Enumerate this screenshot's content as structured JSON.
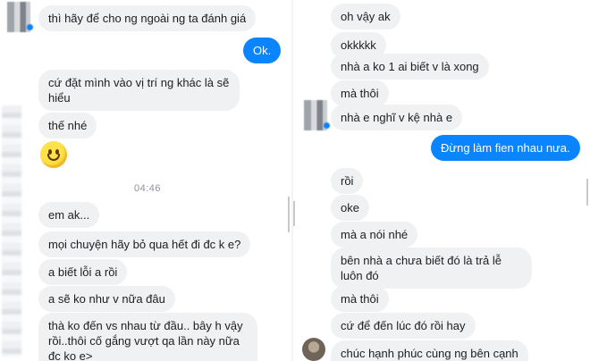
{
  "left_chat": {
    "messages": [
      {
        "text": "thì hãy để cho ng ngoài ng ta đánh giá",
        "direction": "incoming"
      },
      {
        "text": "Ok.",
        "direction": "outgoing"
      },
      {
        "text": "cứ đặt mình vào vị trí ng khác là sẽ hiểu",
        "direction": "incoming"
      },
      {
        "text": "thế nhé",
        "direction": "incoming"
      },
      {
        "emoji": "smiley-face",
        "direction": "incoming"
      },
      {
        "text": "em ak...",
        "direction": "incoming"
      },
      {
        "text": "mọi chuyện hãy bỏ qua hết đi đc k e?",
        "direction": "incoming"
      },
      {
        "text": "a biết lỗi a rồi",
        "direction": "incoming"
      },
      {
        "text": "a sẽ ko như v nữa đâu",
        "direction": "incoming"
      },
      {
        "text": "thà ko đến vs nhau từ đầu.. bây h vậy rồi..thôi cố gắng vượt qa lần này nữa đc ko e>",
        "direction": "incoming"
      }
    ],
    "timestamp": "04:46"
  },
  "right_chat": {
    "messages": [
      {
        "text": "oh vậy ak",
        "direction": "incoming"
      },
      {
        "text": "okkkkk",
        "direction": "incoming"
      },
      {
        "text": "nhà a ko 1 ai biết v là xong",
        "direction": "incoming"
      },
      {
        "text": "mà thôi",
        "direction": "incoming"
      },
      {
        "text": "nhà e nghĩ v kệ nhà e",
        "direction": "incoming"
      },
      {
        "text": "Đừng làm fien nhau nưa.",
        "direction": "outgoing"
      },
      {
        "text": "rồi",
        "direction": "incoming"
      },
      {
        "text": "oke",
        "direction": "incoming"
      },
      {
        "text": "mà a nói nhé",
        "direction": "incoming"
      },
      {
        "text": "bên nhà a chưa biết đó là trả lễ luôn đó",
        "direction": "incoming"
      },
      {
        "text": "mà thôi",
        "direction": "incoming"
      },
      {
        "text": "cứ để đến lúc đó rồi hay",
        "direction": "incoming"
      },
      {
        "text": "chúc hạnh phúc cùng ng bên cạnh",
        "direction": "incoming"
      }
    ]
  },
  "colors": {
    "incoming_bubble": "#f0f1f3",
    "outgoing_bubble": "#0a84ff",
    "timestamp": "#8d949e"
  }
}
